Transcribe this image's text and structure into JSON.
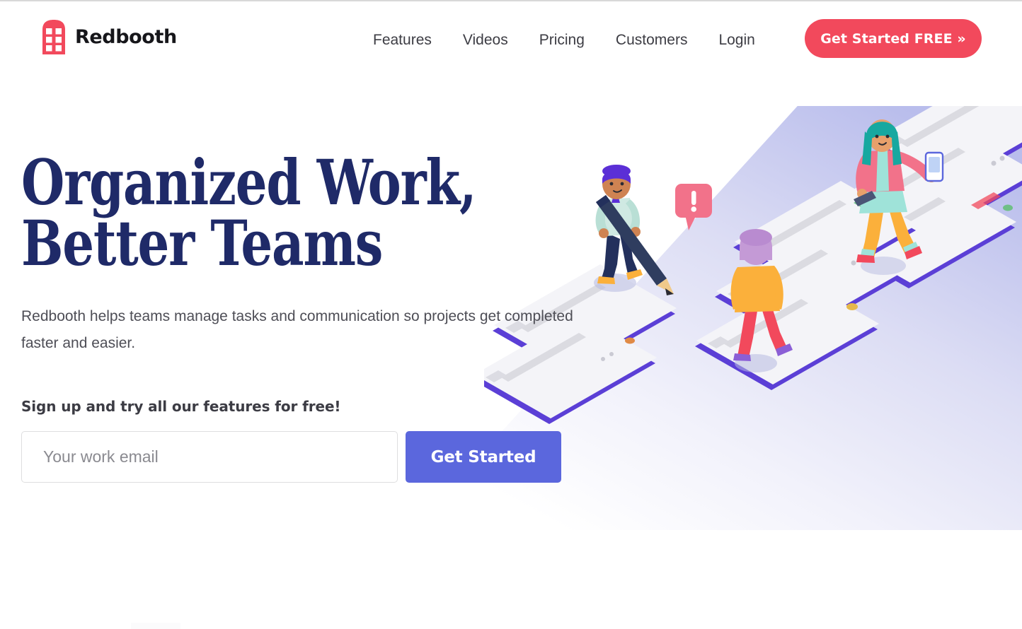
{
  "brand": {
    "name": "Redbooth",
    "logo_icon": "phone-booth-icon",
    "logo_color": "#f2495c"
  },
  "header": {
    "nav": [
      {
        "label": "Features"
      },
      {
        "label": "Videos"
      },
      {
        "label": "Pricing"
      },
      {
        "label": "Customers"
      },
      {
        "label": "Login"
      }
    ],
    "cta_label": "Get Started FREE »",
    "cta_color": "#f2495c"
  },
  "hero": {
    "headline": "Organized Work,\nBetter Teams",
    "headline_color": "#1f2a68",
    "subhead": "Redbooth helps teams manage tasks and communication so projects get completed faster and easier.",
    "signup_label": "Sign up and try all our features for free!",
    "email_placeholder": "Your work email",
    "email_value": "",
    "submit_label": "Get Started",
    "submit_color": "#5b67dd"
  },
  "illustration": {
    "name": "isometric-team-task-board-illustration",
    "description": "Isometric illustration of three people walking across a diagonal row of purple-outlined task cards",
    "palette": {
      "card_outline": "#5b3fd6",
      "card_face": "#f1f1f4",
      "plane_fill": "#c9cdf0",
      "accent_red": "#f2495c",
      "accent_orange": "#fbb03b",
      "accent_teal": "#17a8a0",
      "person_navy": "#23305c"
    },
    "characters": [
      {
        "name": "man-with-pencil",
        "hair": "#5b2fd6",
        "shirt": "#cfe9e2",
        "pants": "#23305c",
        "shoes": "#fbb03b",
        "holding": "pencil"
      },
      {
        "name": "person-orange-sweater",
        "hair": "#c49ad6",
        "top": "#fbb03b",
        "pants": "#f2495c",
        "shoes": "#8b5fd6"
      },
      {
        "name": "woman-with-phone",
        "hair": "#17a8a0",
        "jacket": "#f2728a",
        "skirt": "#9fe3d9",
        "legs": "#fbb03b",
        "shoes": "#f2495c",
        "holding": "smartphone"
      }
    ],
    "badges": [
      {
        "name": "alert-speech-bubble",
        "glyph": "!",
        "color": "#f2728a"
      }
    ]
  }
}
